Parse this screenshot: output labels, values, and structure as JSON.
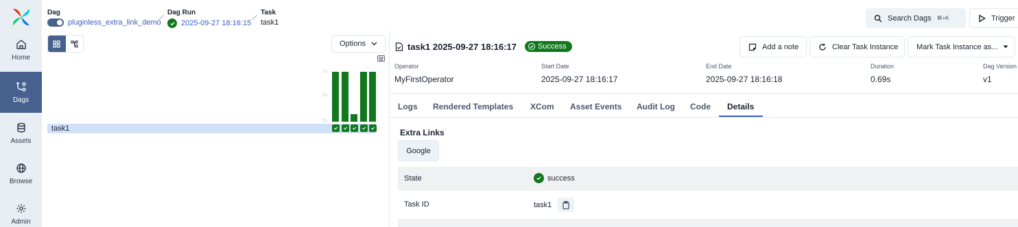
{
  "sidebar": {
    "items": [
      {
        "label": "Home",
        "icon": "home-icon"
      },
      {
        "label": "Dags",
        "icon": "dags-icon",
        "active": true
      },
      {
        "label": "Assets",
        "icon": "database-icon"
      },
      {
        "label": "Browse",
        "icon": "globe-icon"
      },
      {
        "label": "Admin",
        "icon": "gear-icon"
      }
    ]
  },
  "breadcrumb": {
    "dag_title": "Dag",
    "dag_name": "pluginless_extra_link_demo",
    "run_title": "Dag Run",
    "run_name": "2025-09-27 18:16:15",
    "task_title": "Task",
    "task_name": "task1"
  },
  "header": {
    "search_label": "Search Dags",
    "search_shortcut": "⌘+K",
    "trigger_label": "Trigger"
  },
  "grid": {
    "options_label": "Options",
    "axis_top": "1s",
    "axis_mid": "0s",
    "axis_bottom": "0s",
    "task_name": "task1",
    "run_durations": [
      1.0,
      1.0,
      0.15,
      1.0,
      1.0
    ],
    "run_states": [
      "success",
      "success",
      "success",
      "success",
      "success"
    ],
    "success_color": "#11781e"
  },
  "task": {
    "title": "task1 2025-09-27 18:16:17",
    "state_badge": "Success",
    "add_note": "Add a note",
    "clear": "Clear Task Instance",
    "mark": "Mark Task Instance as..."
  },
  "meta": {
    "operator_label": "Operator",
    "operator_value": "MyFirstOperator",
    "start_label": "Start Date",
    "start_value": "2025-09-27 18:16:17",
    "end_label": "End Date",
    "end_value": "2025-09-27 18:16:18",
    "duration_label": "Duration",
    "duration_value": "0.69s",
    "version_label": "Dag Version",
    "version_value": "v1"
  },
  "tabs": [
    "Logs",
    "Rendered Templates",
    "XCom",
    "Asset Events",
    "Audit Log",
    "Code",
    "Details"
  ],
  "details": {
    "extra_links_title": "Extra Links",
    "google_label": "Google",
    "state_label": "State",
    "state_value": "success",
    "task_id_label": "Task ID",
    "task_id_value": "task1"
  }
}
